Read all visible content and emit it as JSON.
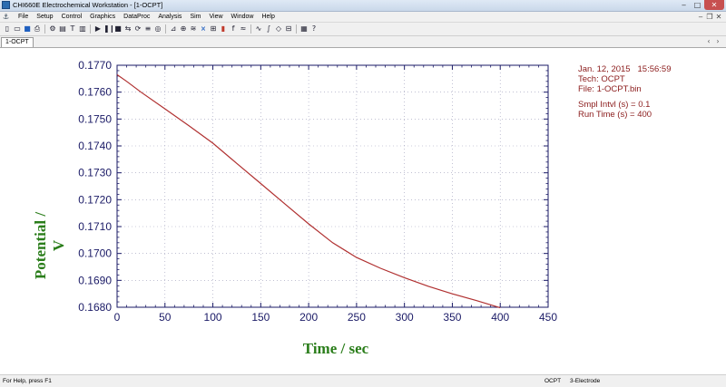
{
  "window": {
    "title": "CHI660E Electrochemical Workstation - [1-OCPT]"
  },
  "menu": [
    "File",
    "Setup",
    "Control",
    "Graphics",
    "DataProc",
    "Analysis",
    "Sim",
    "View",
    "Window",
    "Help"
  ],
  "tabs": [
    {
      "label": "1-OCPT"
    }
  ],
  "info": {
    "date": "Jan. 12, 2015",
    "time": "15:56:59",
    "tech": "Tech: OCPT",
    "file": "File: 1-OCPT.bin",
    "sampling": "Smpl Intvl (s) = 0.1",
    "run_time": "Run Time (s) = 400"
  },
  "status": {
    "help": "For Help, press F1",
    "tech": "OCPT",
    "electrode": "3-Electrode"
  },
  "colors": {
    "axis": "#1a1a66",
    "curve": "#b03030",
    "label": "#2a7d1a",
    "info": "#8b1c1c"
  },
  "chart_data": {
    "type": "line",
    "xlabel": "Time / sec",
    "ylabel": "Potential / V",
    "xlim": [
      0,
      450
    ],
    "ylim": [
      0.168,
      0.177
    ],
    "xticks": [
      "0",
      "50",
      "100",
      "150",
      "200",
      "250",
      "300",
      "350",
      "400",
      "450"
    ],
    "yticks": [
      "0.1770",
      "0.1760",
      "0.1750",
      "0.1740",
      "0.1730",
      "0.1720",
      "0.1710",
      "0.1700",
      "0.1690",
      "0.1680"
    ],
    "grid": true,
    "series": [
      {
        "x": [
          0,
          10,
          25,
          50,
          75,
          100,
          125,
          150,
          175,
          200,
          225,
          250,
          275,
          300,
          325,
          350,
          375,
          400
        ],
        "y": [
          0.17665,
          0.1764,
          0.176,
          0.17538,
          0.17475,
          0.1741,
          0.17335,
          0.1726,
          0.17185,
          0.1711,
          0.1704,
          0.16985,
          0.16945,
          0.1691,
          0.16878,
          0.1685,
          0.16825,
          0.16798
        ]
      }
    ]
  }
}
